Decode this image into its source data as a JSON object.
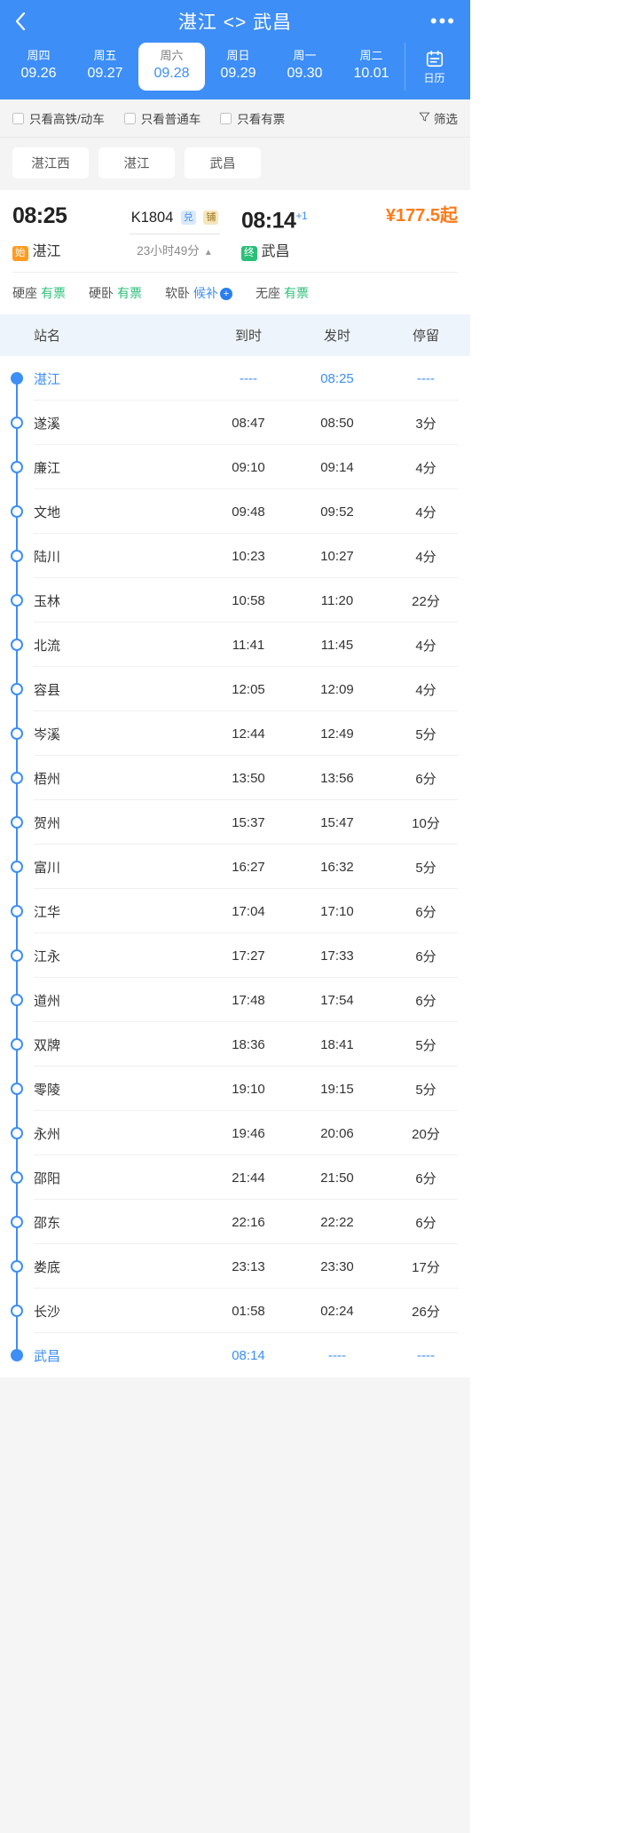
{
  "header": {
    "back_icon": "chevron-left-icon",
    "title": "湛江 <> 武昌",
    "more_icon": "ellipsis-icon",
    "calendar_icon": "calendar-icon",
    "calendar_label": "日历",
    "dates": [
      {
        "weekday": "周四",
        "date": "09.26",
        "active": false
      },
      {
        "weekday": "周五",
        "date": "09.27",
        "active": false
      },
      {
        "weekday": "周六",
        "date": "09.28",
        "active": true
      },
      {
        "weekday": "周日",
        "date": "09.29",
        "active": false
      },
      {
        "weekday": "周一",
        "date": "09.30",
        "active": false
      },
      {
        "weekday": "周二",
        "date": "10.01",
        "active": false
      }
    ]
  },
  "filters": {
    "options": [
      {
        "label": "只看高铁/动车",
        "checked": false
      },
      {
        "label": "只看普通车",
        "checked": false
      },
      {
        "label": "只看有票",
        "checked": false
      }
    ],
    "filter_button": "筛选",
    "filter_icon": "funnel-icon"
  },
  "station_tabs": [
    {
      "label": "湛江西"
    },
    {
      "label": "湛江"
    },
    {
      "label": "武昌"
    }
  ],
  "train": {
    "depart_time": "08:25",
    "depart_station": "湛江",
    "depart_badge": "始",
    "train_no": "K1804",
    "tag_exchange": "兑",
    "tag_berth": "铺",
    "duration": "23小时49分",
    "caret_icon": "caret-up-icon",
    "arrive_time": "08:14",
    "arrive_day_offset": "+1",
    "arrive_station": "武昌",
    "arrive_badge": "终",
    "price": "¥177.5",
    "price_suffix": "起",
    "seats": [
      {
        "label": "硬座",
        "status": "有票",
        "type": "ok"
      },
      {
        "label": "硬卧",
        "status": "有票",
        "type": "ok"
      },
      {
        "label": "软卧",
        "status": "候补",
        "type": "wait"
      },
      {
        "label": "无座",
        "status": "有票",
        "type": "ok"
      }
    ]
  },
  "schedule": {
    "columns": [
      "站名",
      "到时",
      "发时",
      "停留"
    ],
    "rows": [
      {
        "station": "湛江",
        "arrive": "----",
        "depart": "08:25",
        "stop": "----",
        "terminal": true
      },
      {
        "station": "遂溪",
        "arrive": "08:47",
        "depart": "08:50",
        "stop": "3分",
        "terminal": false
      },
      {
        "station": "廉江",
        "arrive": "09:10",
        "depart": "09:14",
        "stop": "4分",
        "terminal": false
      },
      {
        "station": "文地",
        "arrive": "09:48",
        "depart": "09:52",
        "stop": "4分",
        "terminal": false
      },
      {
        "station": "陆川",
        "arrive": "10:23",
        "depart": "10:27",
        "stop": "4分",
        "terminal": false
      },
      {
        "station": "玉林",
        "arrive": "10:58",
        "depart": "11:20",
        "stop": "22分",
        "terminal": false
      },
      {
        "station": "北流",
        "arrive": "11:41",
        "depart": "11:45",
        "stop": "4分",
        "terminal": false
      },
      {
        "station": "容县",
        "arrive": "12:05",
        "depart": "12:09",
        "stop": "4分",
        "terminal": false
      },
      {
        "station": "岑溪",
        "arrive": "12:44",
        "depart": "12:49",
        "stop": "5分",
        "terminal": false
      },
      {
        "station": "梧州",
        "arrive": "13:50",
        "depart": "13:56",
        "stop": "6分",
        "terminal": false
      },
      {
        "station": "贺州",
        "arrive": "15:37",
        "depart": "15:47",
        "stop": "10分",
        "terminal": false
      },
      {
        "station": "富川",
        "arrive": "16:27",
        "depart": "16:32",
        "stop": "5分",
        "terminal": false
      },
      {
        "station": "江华",
        "arrive": "17:04",
        "depart": "17:10",
        "stop": "6分",
        "terminal": false
      },
      {
        "station": "江永",
        "arrive": "17:27",
        "depart": "17:33",
        "stop": "6分",
        "terminal": false
      },
      {
        "station": "道州",
        "arrive": "17:48",
        "depart": "17:54",
        "stop": "6分",
        "terminal": false
      },
      {
        "station": "双牌",
        "arrive": "18:36",
        "depart": "18:41",
        "stop": "5分",
        "terminal": false
      },
      {
        "station": "零陵",
        "arrive": "19:10",
        "depart": "19:15",
        "stop": "5分",
        "terminal": false
      },
      {
        "station": "永州",
        "arrive": "19:46",
        "depart": "20:06",
        "stop": "20分",
        "terminal": false
      },
      {
        "station": "邵阳",
        "arrive": "21:44",
        "depart": "21:50",
        "stop": "6分",
        "terminal": false
      },
      {
        "station": "邵东",
        "arrive": "22:16",
        "depart": "22:22",
        "stop": "6分",
        "terminal": false
      },
      {
        "station": "娄底",
        "arrive": "23:13",
        "depart": "23:30",
        "stop": "17分",
        "terminal": false
      },
      {
        "station": "长沙",
        "arrive": "01:58",
        "depart": "02:24",
        "stop": "26分",
        "terminal": false
      },
      {
        "station": "武昌",
        "arrive": "08:14",
        "depart": "----",
        "stop": "----",
        "terminal": true
      }
    ]
  },
  "colors": {
    "brand": "#3d8ef7",
    "price": "#ff7a18",
    "ok": "#2bbf77",
    "start_badge": "#ff9b21",
    "end_badge": "#2bbf77"
  }
}
